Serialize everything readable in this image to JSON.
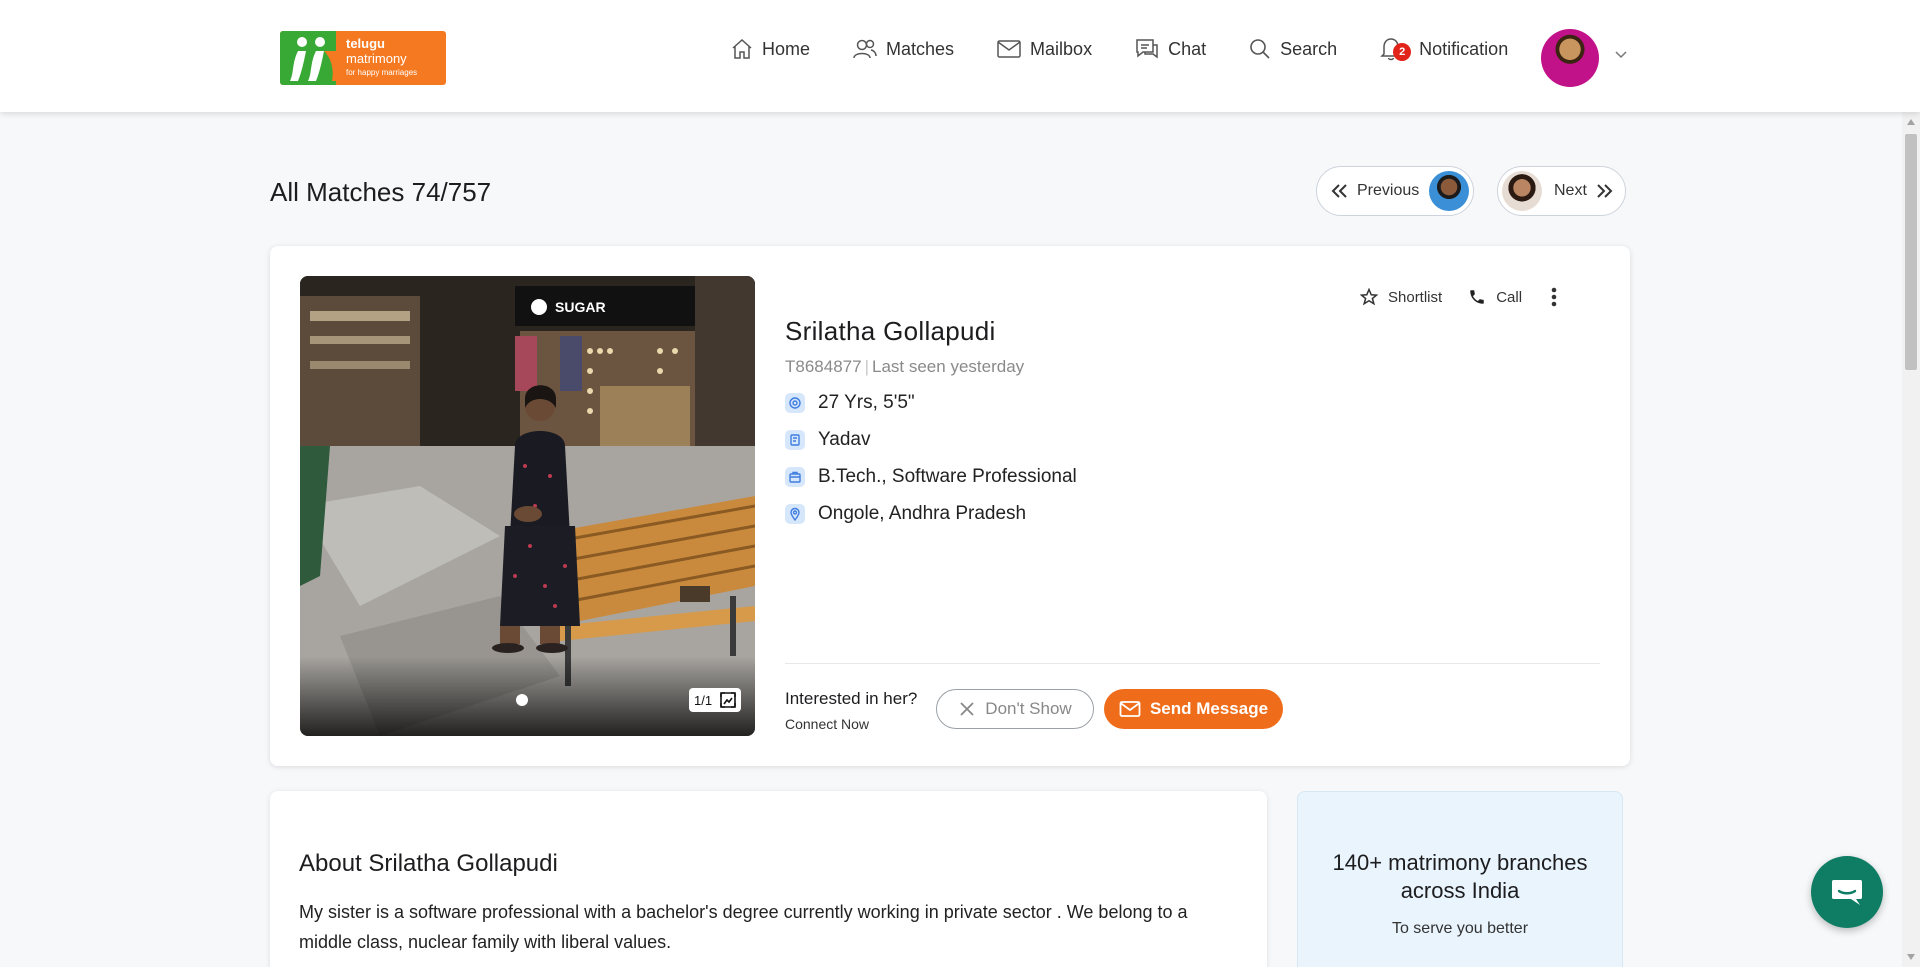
{
  "brand": {
    "logo_line1": "telugu",
    "logo_line2": "matrimony",
    "logo_tagline": "for happy marriages",
    "accent": "#ef6c1a",
    "logo_green": "#39a935",
    "logo_orange": "#f47920"
  },
  "nav": {
    "items": [
      {
        "label": "Home",
        "icon": "home-icon"
      },
      {
        "label": "Matches",
        "icon": "users-icon"
      },
      {
        "label": "Mailbox",
        "icon": "mail-icon"
      },
      {
        "label": "Chat",
        "icon": "chat-icon"
      },
      {
        "label": "Search",
        "icon": "search-icon"
      },
      {
        "label": "Notification",
        "icon": "bell-icon"
      }
    ],
    "notification_count": "2"
  },
  "page": {
    "title": "All Matches 74/757",
    "prev_label": "Previous",
    "next_label": "Next"
  },
  "profile": {
    "name": "Srilatha Gollapudi",
    "id": "T8684877",
    "last_seen": "Last seen yesterday",
    "attributes": [
      {
        "icon": "age-icon",
        "value": "27 Yrs, 5'5\""
      },
      {
        "icon": "community-icon",
        "value": "Yadav"
      },
      {
        "icon": "education-icon",
        "value": "B.Tech., Software Professional"
      },
      {
        "icon": "location-icon",
        "value": "Ongole, Andhra Pradesh"
      }
    ],
    "photo_count": "1/1",
    "photo_store_sign": "SUGAR",
    "shortlist_label": "Shortlist",
    "call_label": "Call",
    "interest_question": "Interested in her?",
    "interest_sub": "Connect Now",
    "dont_show_label": "Don't Show",
    "send_message_label": "Send Message"
  },
  "about": {
    "heading": "About Srilatha Gollapudi",
    "text": "My sister is a software professional with a bachelor's degree currently working in private sector . We belong to a middle class, nuclear family with liberal values."
  },
  "promo": {
    "title": "140+ matrimony branches across India",
    "subtitle": "To serve you better"
  }
}
